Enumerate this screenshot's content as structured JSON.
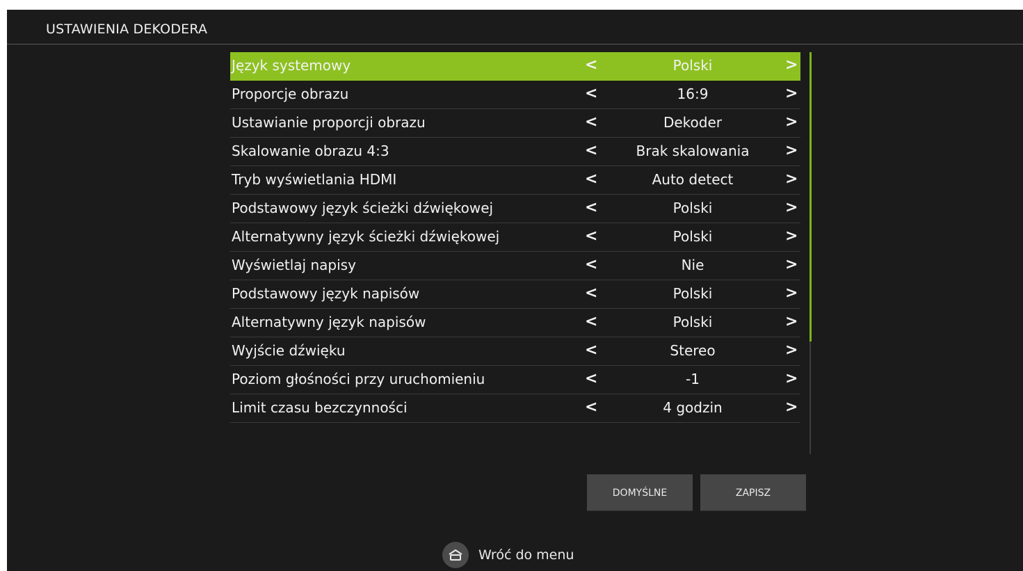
{
  "header": {
    "title": "USTAWIENIA DEKODERA"
  },
  "settings": [
    {
      "label": "Język systemowy",
      "value": "Polski",
      "selected": true
    },
    {
      "label": "Proporcje obrazu",
      "value": "16:9"
    },
    {
      "label": "Ustawianie proporcji obrazu",
      "value": "Dekoder"
    },
    {
      "label": "Skalowanie obrazu 4:3",
      "value": "Brak skalowania"
    },
    {
      "label": "Tryb wyświetlania HDMI",
      "value": "Auto detect"
    },
    {
      "label": "Podstawowy język ścieżki dźwiękowej",
      "value": "Polski"
    },
    {
      "label": "Alternatywny język ścieżki dźwiękowej",
      "value": "Polski"
    },
    {
      "label": "Wyświetlaj napisy",
      "value": "Nie"
    },
    {
      "label": "Podstawowy język napisów",
      "value": "Polski"
    },
    {
      "label": "Alternatywny język napisów",
      "value": "Polski"
    },
    {
      "label": "Wyjście dźwięku",
      "value": "Stereo"
    },
    {
      "label": "Poziom głośności przy uruchomieniu",
      "value": "-1"
    },
    {
      "label": "Limit czasu bezczynności",
      "value": "4 godzin"
    }
  ],
  "arrows": {
    "left": "<",
    "right": ">"
  },
  "buttons": {
    "default_label": "DOMYŚLNE",
    "save_label": "ZAPISZ"
  },
  "footer": {
    "back_label": "Wróć do menu",
    "icon": "home-icon"
  },
  "colors": {
    "accent": "#8dc121",
    "background": "#1b1b1b",
    "button": "#464646"
  }
}
